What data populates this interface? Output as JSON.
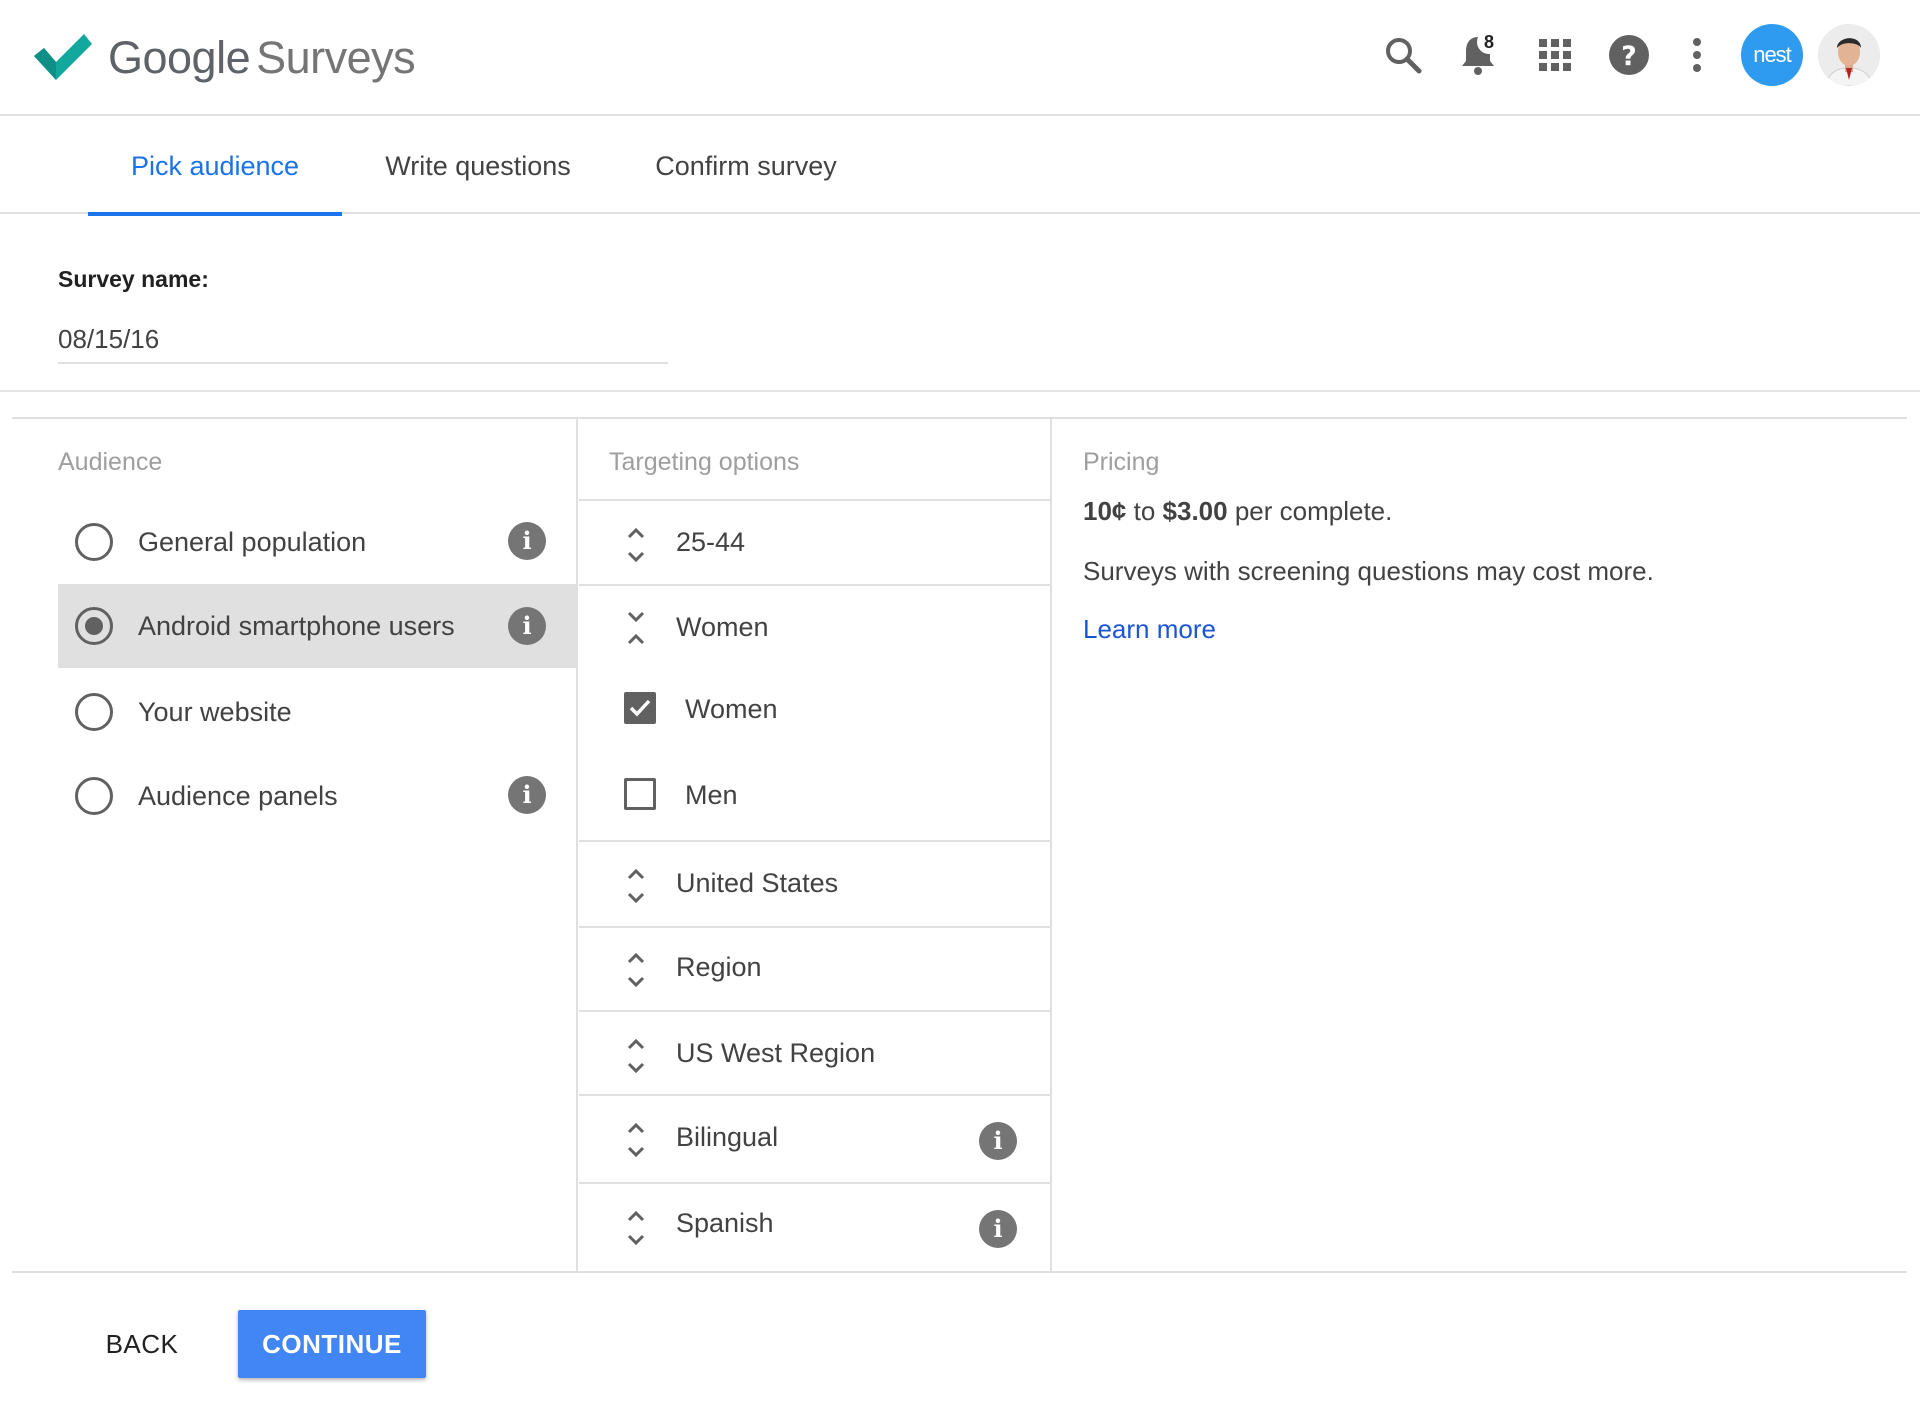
{
  "app": {
    "brand_google": "Google",
    "brand_product": "Surveys",
    "logo_icon": "checkmark-logo",
    "accent_color": "#1a73e8",
    "logo_color": "#13a89e"
  },
  "header": {
    "notification_count": "8",
    "nest_avatar_text": "nest",
    "icons": [
      "search-icon",
      "bell-icon",
      "apps-grid-icon",
      "help-icon",
      "more-vert-icon"
    ]
  },
  "tabs": [
    {
      "label": "Pick audience",
      "active": true
    },
    {
      "label": "Write questions",
      "active": false
    },
    {
      "label": "Confirm survey",
      "active": false
    }
  ],
  "survey_name": {
    "label": "Survey name:",
    "value": "08/15/16"
  },
  "audience": {
    "title": "Audience",
    "options": [
      {
        "label": "General population",
        "selected": false,
        "info": true
      },
      {
        "label": "Android smartphone users",
        "selected": true,
        "info": true
      },
      {
        "label": "Your website",
        "selected": false,
        "info": false
      },
      {
        "label": "Audience panels",
        "selected": false,
        "info": true
      }
    ]
  },
  "targeting": {
    "title": "Targeting options",
    "age": "25-44",
    "gender_header": "Women",
    "gender_options": [
      {
        "label": "Women",
        "checked": true
      },
      {
        "label": "Men",
        "checked": false
      }
    ],
    "country": "United States",
    "geo_type": "Region",
    "region": "US West Region",
    "language_mode": "Bilingual",
    "language": "Spanish"
  },
  "pricing": {
    "title": "Pricing",
    "price_low": "10¢",
    "price_to": " to ",
    "price_high": "$3.00",
    "price_suffix": " per complete.",
    "note": "Surveys with screening questions may cost more.",
    "learn_more": "Learn more"
  },
  "footer": {
    "back_label": "BACK",
    "continue_label": "CONTINUE"
  }
}
